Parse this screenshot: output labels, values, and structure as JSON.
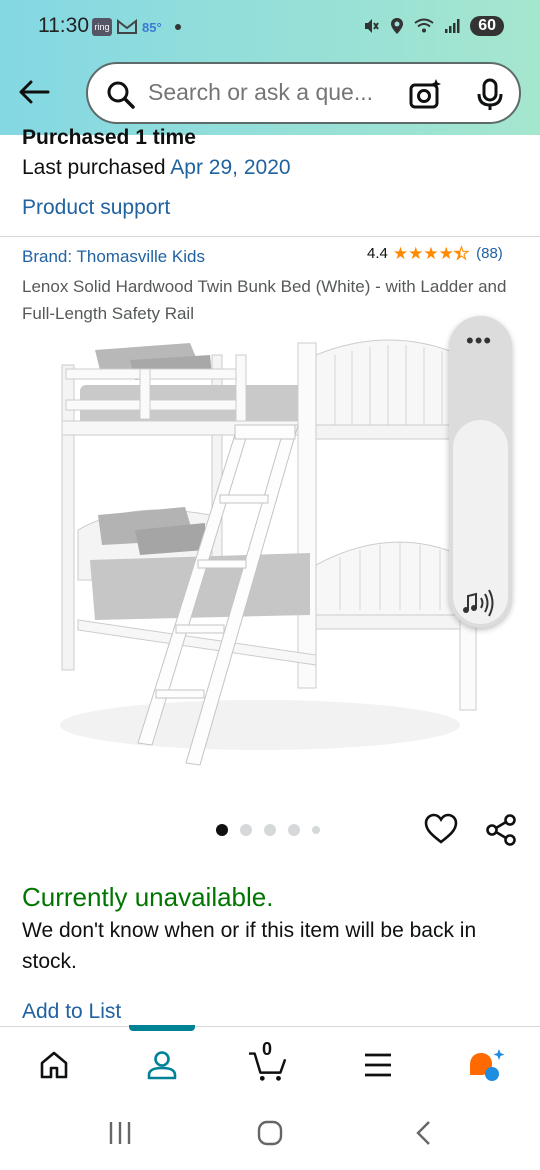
{
  "status_bar": {
    "time": "11:30",
    "ring_label": "ring",
    "temperature": "85°",
    "battery": "60"
  },
  "search": {
    "placeholder": "Search or ask a que..."
  },
  "purchase": {
    "count_text": "Purchased 1 time",
    "last_label": "Last purchased",
    "last_date": "Apr 29, 2020",
    "support_link": "Product support"
  },
  "product": {
    "brand": "Brand: Thomasville Kids",
    "rating": "4.4",
    "rating_count": "(88)",
    "stars_value": 4.4,
    "title": "Lenox Solid Hardwood Twin Bunk Bed (White) - with Ladder and Full-Length Safety Rail",
    "image_count": 5,
    "active_image": 1
  },
  "availability": {
    "status": "Currently unavailable.",
    "message": "We don't know when or if this item will be back in stock.",
    "add_to_list": "Add to List"
  },
  "bottom_nav": {
    "cart_count": "0",
    "active": "account"
  },
  "colors": {
    "link": "#2162a1",
    "available_green": "#007600",
    "star": "#ff8a00",
    "nav_accent": "#008296"
  }
}
